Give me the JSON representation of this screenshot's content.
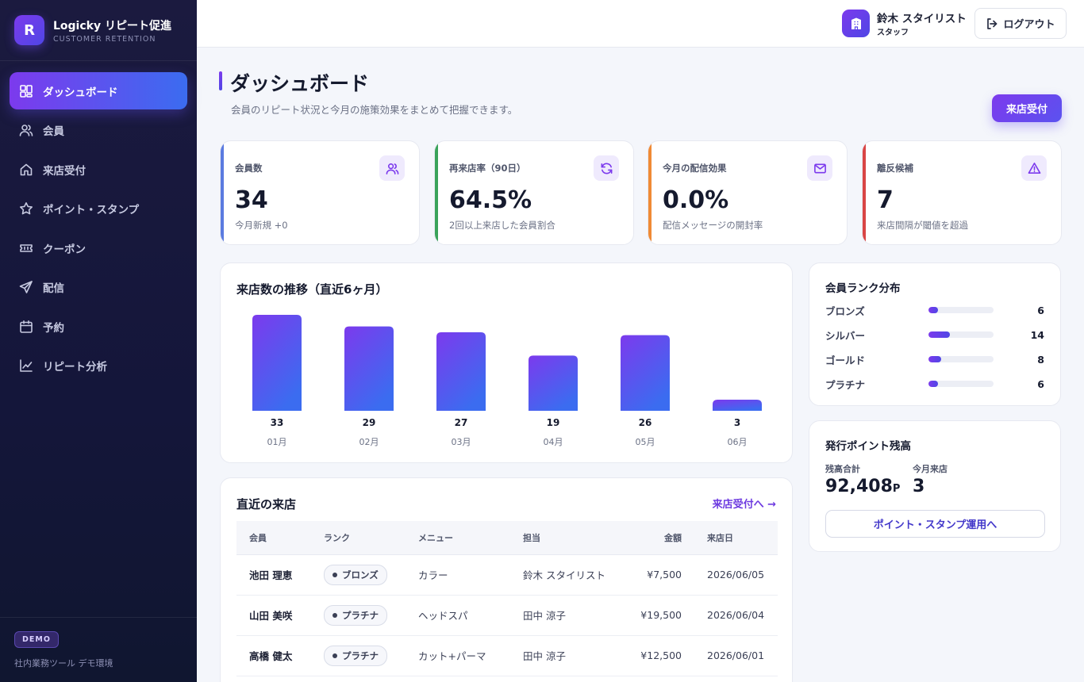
{
  "brand": {
    "logo_letter": "R",
    "name": "Logicky リピート促進",
    "subtitle": "CUSTOMER RETENTION"
  },
  "nav": [
    {
      "label": "ダッシュボード",
      "icon": "dashboard-icon",
      "active": true
    },
    {
      "label": "会員",
      "icon": "users-icon"
    },
    {
      "label": "来店受付",
      "icon": "home-icon"
    },
    {
      "label": "ポイント・スタンプ",
      "icon": "star-icon"
    },
    {
      "label": "クーポン",
      "icon": "ticket-icon"
    },
    {
      "label": "配信",
      "icon": "send-icon"
    },
    {
      "label": "予約",
      "icon": "calendar-icon"
    },
    {
      "label": "リピート分析",
      "icon": "chart-line-icon"
    }
  ],
  "sidebar_footer": {
    "badge": "DEMO",
    "text": "社内業務ツール デモ環境"
  },
  "header": {
    "user_name": "鈴木 スタイリスト",
    "user_role": "スタッフ",
    "logout_label": "ログアウト"
  },
  "page": {
    "title": "ダッシュボード",
    "description": "会員のリピート状況と今月の施策効果をまとめて把握できます。",
    "action_label": "来店受付"
  },
  "stats": [
    {
      "label": "会員数",
      "value": "34",
      "sub": "今月新規 +0",
      "icon": "users-icon",
      "accent": "#5b7be0"
    },
    {
      "label": "再来店率（90日）",
      "value": "64.5%",
      "sub": "2回以上来店した会員割合",
      "icon": "refresh-icon",
      "accent": "#3aa35a"
    },
    {
      "label": "今月の配信効果",
      "value": "0.0%",
      "sub": "配信メッセージの開封率",
      "icon": "mail-icon",
      "accent": "#f08a35"
    },
    {
      "label": "離反候補",
      "value": "7",
      "sub": "来店間隔が閾値を超過",
      "icon": "alert-icon",
      "accent": "#d94545"
    }
  ],
  "visits_chart": {
    "title": "来店数の推移（直近6ヶ月）"
  },
  "chart_data": {
    "type": "bar",
    "categories": [
      "01月",
      "02月",
      "03月",
      "04月",
      "05月",
      "06月"
    ],
    "values": [
      33,
      29,
      27,
      19,
      26,
      3
    ],
    "title": "来店数の推移（直近6ヶ月）",
    "xlabel": "",
    "ylabel": "",
    "grid": false,
    "colors": [
      "#7c3aed",
      "#3b6cf0"
    ]
  },
  "rank_distribution": {
    "title": "会員ランク分布",
    "items": [
      {
        "name": "ブロンズ",
        "count": "6",
        "value": 6
      },
      {
        "name": "シルバー",
        "count": "14",
        "value": 14
      },
      {
        "name": "ゴールド",
        "count": "8",
        "value": 8
      },
      {
        "name": "プラチナ",
        "count": "6",
        "value": 6
      }
    ]
  },
  "points": {
    "title": "発行ポイント残高",
    "balance_label": "残高合計",
    "balance_value": "92,408",
    "balance_unit": "P",
    "visits_label": "今月来店",
    "visits_value": "3",
    "link_label": "ポイント・スタンプ運用へ"
  },
  "recent_visits": {
    "title": "直近の来店",
    "link_label": "来店受付へ →",
    "columns": [
      "会員",
      "ランク",
      "メニュー",
      "担当",
      "金額",
      "来店日"
    ],
    "rows": [
      {
        "member": "池田 理恵",
        "rank": "ブロンズ",
        "menu": "カラー",
        "staff": "鈴木 スタイリスト",
        "amount": "¥7,500",
        "date": "2026/06/05"
      },
      {
        "member": "山田 美咲",
        "rank": "プラチナ",
        "menu": "ヘッドスパ",
        "staff": "田中 涼子",
        "amount": "¥19,500",
        "date": "2026/06/04"
      },
      {
        "member": "高橋 健太",
        "rank": "プラチナ",
        "menu": "カット+パーマ",
        "staff": "田中 涼子",
        "amount": "¥12,500",
        "date": "2026/06/01"
      }
    ]
  }
}
